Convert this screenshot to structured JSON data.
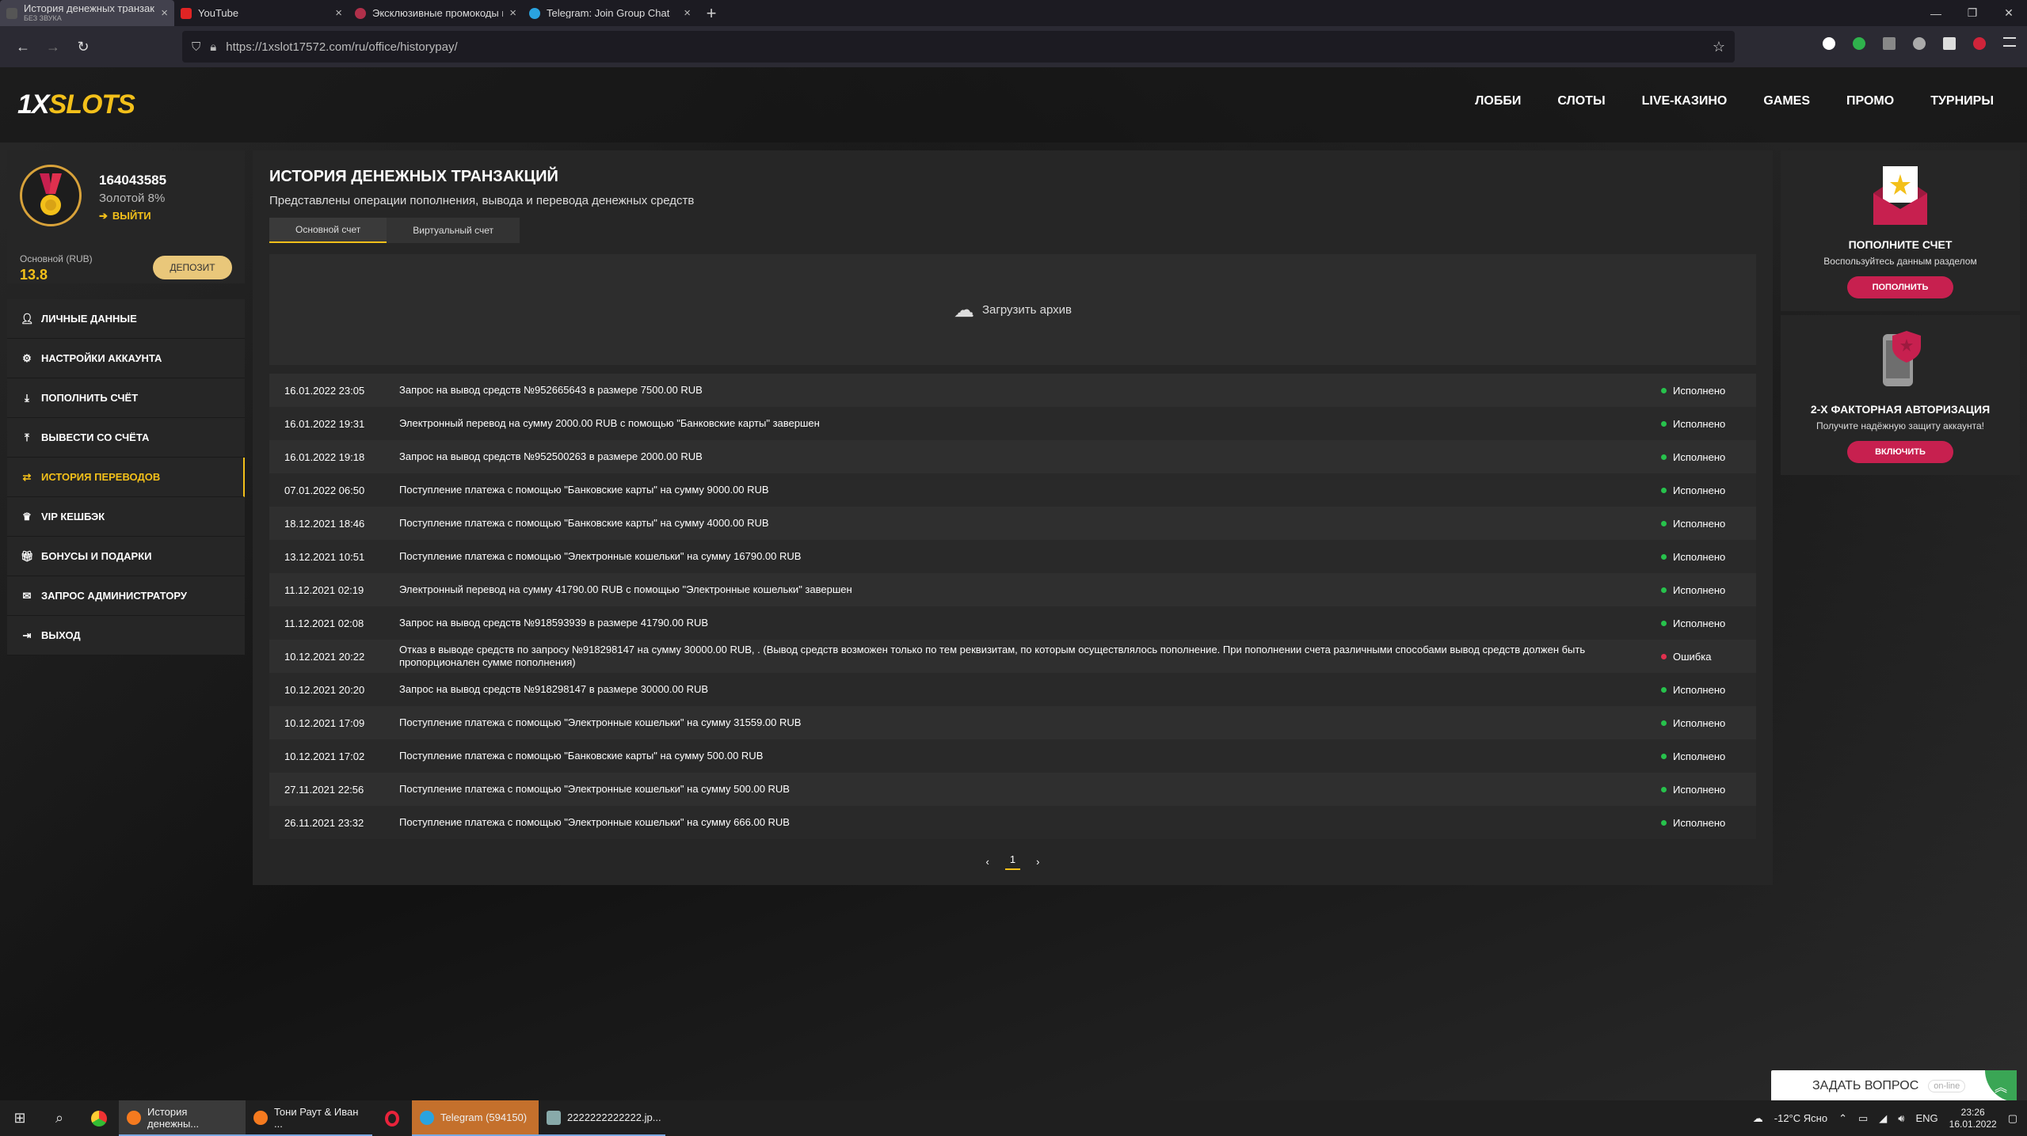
{
  "browser": {
    "tabs": [
      {
        "title": "История денежных транзакций",
        "subtitle": "БЕЗ ЗВУКА",
        "active": true
      },
      {
        "title": "YouTube",
        "subtitle": "",
        "active": false
      },
      {
        "title": "Эксклюзивные промокоды на",
        "subtitle": "",
        "active": false
      },
      {
        "title": "Telegram: Join Group Chat",
        "subtitle": "",
        "active": false
      }
    ],
    "url": "https://1xslot17572.com/ru/office/historypay/"
  },
  "site": {
    "logo_a": "1X",
    "logo_b": "SLOTS",
    "nav": [
      "ЛОББИ",
      "СЛОТЫ",
      "LIVE-КАЗИНО",
      "GAMES",
      "ПРОМО",
      "ТУРНИРЫ"
    ]
  },
  "profile": {
    "user_id": "164043585",
    "level": "Золотой 8%",
    "logout": "ВЫЙТИ",
    "balance_label": "Основной (RUB)",
    "balance_value": "13.8",
    "deposit_button": "ДЕПОЗИТ"
  },
  "side_menu": [
    {
      "label": "ЛИЧНЫЕ ДАННЫЕ",
      "icon": "user-icon"
    },
    {
      "label": "НАСТРОЙКИ АККАУНТА",
      "icon": "user-settings-icon"
    },
    {
      "label": "ПОПОЛНИТЬ СЧЁТ",
      "icon": "deposit-icon"
    },
    {
      "label": "ВЫВЕСТИ СО СЧЁТА",
      "icon": "withdraw-icon"
    },
    {
      "label": "ИСТОРИЯ ПЕРЕВОДОВ",
      "icon": "transfer-icon",
      "active": true
    },
    {
      "label": "VIP КЕШБЭК",
      "icon": "crown-icon"
    },
    {
      "label": "БОНУСЫ И ПОДАРКИ",
      "icon": "gift-icon"
    },
    {
      "label": "ЗАПРОС АДМИНИСТРАТОРУ",
      "icon": "mail-icon"
    },
    {
      "label": "ВЫХОД",
      "icon": "exit-icon"
    }
  ],
  "main": {
    "title": "ИСТОРИЯ ДЕНЕЖНЫХ ТРАНЗАКЦИЙ",
    "subtitle": "Представлены операции пополнения, вывода и перевода денежных средств",
    "tabs": [
      "Основной счет",
      "Виртуальный счет"
    ],
    "archive_label": "Загрузить архив",
    "transactions": [
      {
        "date": "16.01.2022 23:05",
        "desc": "Запрос на вывод средств №952665643 в размере 7500.00 RUB",
        "status": "Исполнено",
        "ok": true
      },
      {
        "date": "16.01.2022 19:31",
        "desc": "Электронный перевод на сумму 2000.00 RUB с помощью \"Банковские карты\" завершен",
        "status": "Исполнено",
        "ok": true
      },
      {
        "date": "16.01.2022 19:18",
        "desc": "Запрос на вывод средств №952500263 в размере 2000.00 RUB",
        "status": "Исполнено",
        "ok": true
      },
      {
        "date": "07.01.2022 06:50",
        "desc": "Поступление платежа с помощью \"Банковские карты\" на сумму 9000.00 RUB",
        "status": "Исполнено",
        "ok": true
      },
      {
        "date": "18.12.2021 18:46",
        "desc": "Поступление платежа с помощью \"Банковские карты\" на сумму 4000.00 RUB",
        "status": "Исполнено",
        "ok": true
      },
      {
        "date": "13.12.2021 10:51",
        "desc": "Поступление платежа с помощью \"Электронные кошельки\" на сумму 16790.00 RUB",
        "status": "Исполнено",
        "ok": true
      },
      {
        "date": "11.12.2021 02:19",
        "desc": "Электронный перевод на сумму 41790.00 RUB с помощью \"Электронные кошельки\" завершен",
        "status": "Исполнено",
        "ok": true
      },
      {
        "date": "11.12.2021 02:08",
        "desc": "Запрос на вывод средств №918593939 в размере 41790.00 RUB",
        "status": "Исполнено",
        "ok": true
      },
      {
        "date": "10.12.2021 20:22",
        "desc": "Отказ в выводе средств по запросу №918298147 на сумму 30000.00 RUB, . (Вывод средств возможен только по тем реквизитам, по которым осуществлялось пополнение. При пополнении счета различными способами вывод средств должен быть пропорционален сумме пополнения)",
        "status": "Ошибка",
        "ok": false
      },
      {
        "date": "10.12.2021 20:20",
        "desc": "Запрос на вывод средств №918298147 в размере 30000.00 RUB",
        "status": "Исполнено",
        "ok": true
      },
      {
        "date": "10.12.2021 17:09",
        "desc": "Поступление платежа с помощью \"Электронные кошельки\" на сумму 31559.00 RUB",
        "status": "Исполнено",
        "ok": true
      },
      {
        "date": "10.12.2021 17:02",
        "desc": "Поступление платежа с помощью \"Банковские карты\" на сумму 500.00 RUB",
        "status": "Исполнено",
        "ok": true
      },
      {
        "date": "27.11.2021 22:56",
        "desc": "Поступление платежа с помощью \"Электронные кошельки\" на сумму 500.00 RUB",
        "status": "Исполнено",
        "ok": true
      },
      {
        "date": "26.11.2021 23:32",
        "desc": "Поступление платежа с помощью \"Электронные кошельки\" на сумму 666.00 RUB",
        "status": "Исполнено",
        "ok": true
      }
    ],
    "pager": {
      "prev": "‹",
      "current": "1",
      "next": "›"
    }
  },
  "widgets": [
    {
      "title": "ПОПОЛНИТЕ СЧЕТ",
      "subtitle": "Воспользуйтесь данным разделом",
      "button": "ПОПОЛНИТЬ"
    },
    {
      "title": "2-Х ФАКТОРНАЯ АВТОРИЗАЦИЯ",
      "subtitle": "Получите надёжную защиту аккаунта!",
      "button": "ВКЛЮЧИТЬ"
    }
  ],
  "chat": {
    "label": "ЗАДАТЬ ВОПРОС",
    "status": "on-line"
  },
  "taskbar": {
    "apps": [
      {
        "label": "История денежны...",
        "active": true
      },
      {
        "label": "Тони Раут & Иван ...",
        "active": false
      },
      {
        "label": "Telegram (594150)",
        "active": false
      },
      {
        "label": "2222222222222.jp...",
        "active": false
      }
    ],
    "weather": "-12°C Ясно",
    "lang": "ENG",
    "time": "23:26",
    "date": "16.01.2022"
  },
  "colors": {
    "accent": "#f3c01a",
    "pink": "#c7204f",
    "ok": "#27c24c",
    "error": "#e0304e"
  }
}
